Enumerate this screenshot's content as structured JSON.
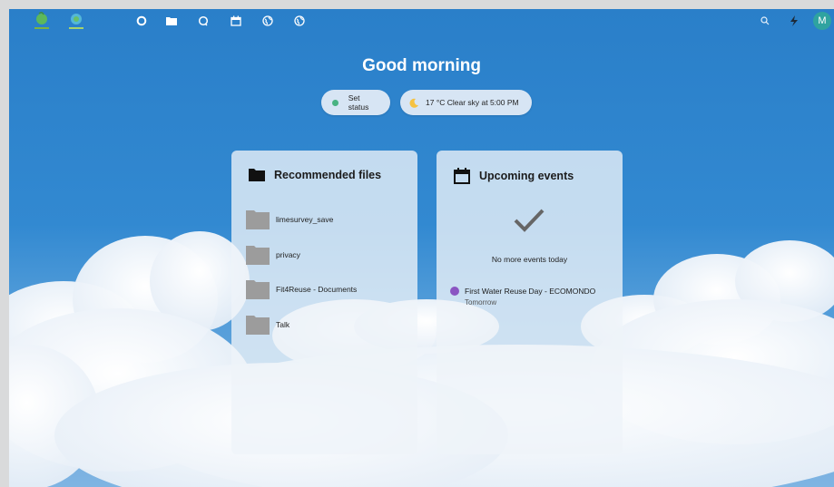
{
  "nav": {
    "icons": [
      "dashboard-icon",
      "files-icon",
      "search-circle-icon",
      "calendar-icon",
      "globe-icon",
      "globe-alt-icon"
    ],
    "right_icons": [
      "search-icon",
      "activity-icon"
    ],
    "avatar_initial": "M"
  },
  "greeting": "Good morning",
  "status": {
    "label": "Set status",
    "color": "#49b382"
  },
  "weather": {
    "label": "17 °C Clear sky at 5:00 PM"
  },
  "recommended_files": {
    "title": "Recommended files",
    "items": [
      {
        "name": "limesurvey_save"
      },
      {
        "name": "privacy"
      },
      {
        "name": "Fit4Reuse - Documents"
      },
      {
        "name": "Talk"
      }
    ]
  },
  "upcoming_events": {
    "title": "Upcoming events",
    "empty_text": "No more events today",
    "events": [
      {
        "title": "First Water Reuse Day - ECOMONDO",
        "when": "Tomorrow",
        "color": "#8a55c2"
      }
    ]
  },
  "colors": {
    "background_top": "#2a7fc9",
    "card_bg": "#eef3f9",
    "folder": "#9c9c9c"
  }
}
